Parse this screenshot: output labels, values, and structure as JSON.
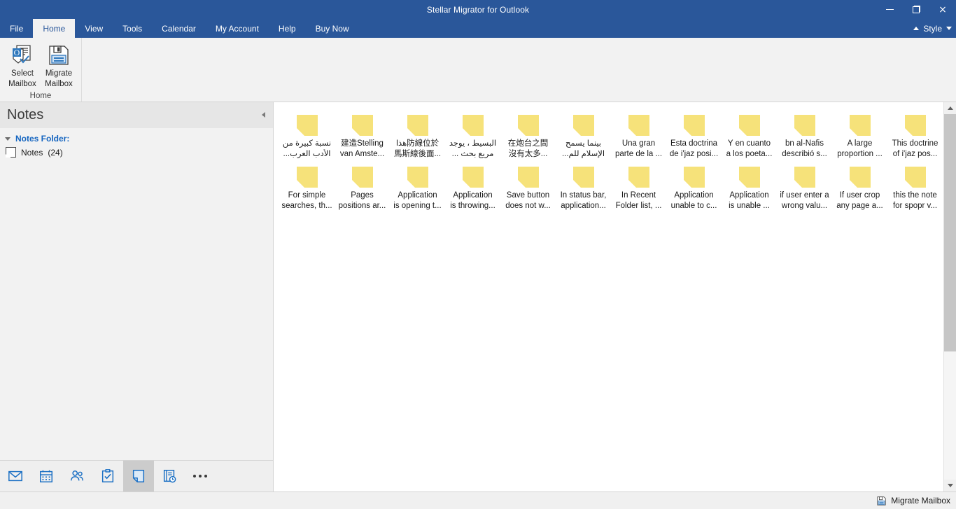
{
  "window": {
    "title": "Stellar Migrator for Outlook",
    "controls": [
      {
        "name": "minimize-button",
        "icon": "minimize-icon"
      },
      {
        "name": "restore-button",
        "icon": "restore-icon"
      },
      {
        "name": "close-button",
        "icon": "close-icon",
        "glyph": "×"
      }
    ]
  },
  "colors": {
    "titlebar_blue": "#2a579a",
    "accent_blue": "#1565c0",
    "note_yellow": "#f6e27a",
    "ribbon_gray": "#f2f2f2",
    "sidebar_gray": "#f2f2f2",
    "selected_nav": "#cccccc"
  },
  "tabs": [
    {
      "label": "File",
      "active": false
    },
    {
      "label": "Home",
      "active": true
    },
    {
      "label": "View",
      "active": false
    },
    {
      "label": "Tools",
      "active": false
    },
    {
      "label": "Calendar",
      "active": false
    },
    {
      "label": "My Account",
      "active": false
    },
    {
      "label": "Help",
      "active": false
    },
    {
      "label": "Buy Now",
      "active": false
    }
  ],
  "style_menu": {
    "label": "Style"
  },
  "ribbon": {
    "group_title": "Home",
    "buttons": [
      {
        "label_line1": "Select",
        "label_line2": "Mailbox",
        "icon": "select-mailbox-icon"
      },
      {
        "label_line1": "Migrate",
        "label_line2": "Mailbox",
        "icon": "migrate-mailbox-icon"
      }
    ]
  },
  "sidebar": {
    "title": "Notes",
    "collapse_icon": "collapse-left-icon",
    "tree": {
      "root_label": "Notes Folder:",
      "items": [
        {
          "label": "Notes",
          "count": "(24)",
          "icon": "note-icon"
        }
      ]
    },
    "nav": [
      {
        "name": "mail",
        "icon": "mail-icon",
        "active": false
      },
      {
        "name": "calendar",
        "icon": "calendar-icon",
        "active": false
      },
      {
        "name": "people",
        "icon": "people-icon",
        "active": false
      },
      {
        "name": "tasks",
        "icon": "tasks-icon",
        "active": false
      },
      {
        "name": "notes",
        "icon": "notes-icon",
        "active": true
      },
      {
        "name": "journal",
        "icon": "journal-icon",
        "active": false
      },
      {
        "name": "more",
        "icon": "more-dots-icon",
        "active": false
      }
    ]
  },
  "notes": [
    {
      "line1": "نسبة كبيرة من",
      "line2": "الأدب العرب...",
      "rtl": true
    },
    {
      "line1": "建造Stelling",
      "line2": "van Amste...",
      "rtl": false
    },
    {
      "line1": "هذا防線位於",
      "line2": "馬斯線後面...",
      "rtl": false
    },
    {
      "line1": "البسيط ، يوجد",
      "line2": "مريع بحث ...",
      "rtl": true
    },
    {
      "line1": "在炮台之間",
      "line2": "沒有太多...",
      "rtl": false
    },
    {
      "line1": "بينما يسمح",
      "line2": "الإسلام للم...",
      "rtl": true
    },
    {
      "line1": "Una gran",
      "line2": "parte de la ...",
      "rtl": false
    },
    {
      "line1": "Esta doctrina",
      "line2": "de i'jaz posi...",
      "rtl": false
    },
    {
      "line1": "Y en cuanto",
      "line2": "a los poeta...",
      "rtl": false
    },
    {
      "line1": "bn al-Nafis",
      "line2": "describió s...",
      "rtl": false
    },
    {
      "line1": "A large",
      "line2": "proportion ...",
      "rtl": false
    },
    {
      "line1": "This doctrine",
      "line2": "of i'jaz pos...",
      "rtl": false
    },
    {
      "line1": "For simple",
      "line2": "searches, th...",
      "rtl": false
    },
    {
      "line1": "Pages",
      "line2": "positions ar...",
      "rtl": false
    },
    {
      "line1": "Application",
      "line2": "is opening t...",
      "rtl": false
    },
    {
      "line1": "Application",
      "line2": "is throwing...",
      "rtl": false
    },
    {
      "line1": "Save button",
      "line2": "does not w...",
      "rtl": false
    },
    {
      "line1": "In status bar,",
      "line2": "application...",
      "rtl": false
    },
    {
      "line1": "In Recent",
      "line2": "Folder list, ...",
      "rtl": false
    },
    {
      "line1": "Application",
      "line2": "unable to c...",
      "rtl": false
    },
    {
      "line1": "Application",
      "line2": "is unable ...",
      "rtl": false
    },
    {
      "line1": "if user enter a",
      "line2": "wrong valu...",
      "rtl": false
    },
    {
      "line1": "If user crop",
      "line2": "any page a...",
      "rtl": false
    },
    {
      "line1": "this the note",
      "line2": "for spopr v...",
      "rtl": false
    }
  ],
  "scrollbar": {
    "up_icon": "scroll-up-icon",
    "down_icon": "scroll-down-icon",
    "thumb_percent": 65
  },
  "statusbar": {
    "label": "Migrate Mailbox",
    "icon": "migrate-mailbox-icon"
  }
}
